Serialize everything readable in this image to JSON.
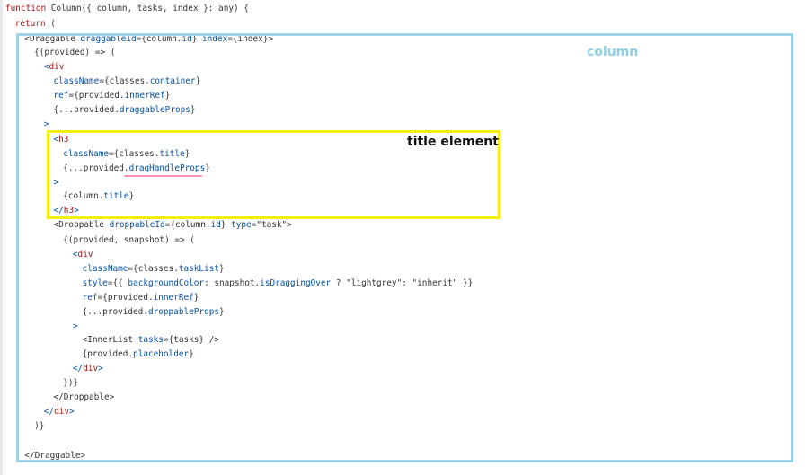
{
  "code_lines": [
    {
      "indent": "",
      "segments": [
        {
          "t": "kw",
          "v": "function"
        },
        {
          "t": "txt",
          "v": " Column({ column, tasks, index }: any) {"
        }
      ]
    },
    {
      "indent": "  ",
      "segments": [
        {
          "t": "kw",
          "v": "return"
        },
        {
          "t": "txt",
          "v": " ("
        }
      ]
    },
    {
      "indent": "    ",
      "segments": [
        {
          "t": "txt",
          "v": "<"
        },
        {
          "t": "txt",
          "v": "Draggable"
        },
        {
          "t": "txt",
          "v": " "
        },
        {
          "t": "attr",
          "v": "draggableId"
        },
        {
          "t": "txt",
          "v": "={column."
        },
        {
          "t": "prop",
          "v": "id"
        },
        {
          "t": "txt",
          "v": "} "
        },
        {
          "t": "attr",
          "v": "index"
        },
        {
          "t": "txt",
          "v": "={index}>"
        }
      ]
    },
    {
      "indent": "      ",
      "segments": [
        {
          "t": "txt",
          "v": "{(provided) => ("
        }
      ]
    },
    {
      "indent": "        ",
      "segments": [
        {
          "t": "punc",
          "v": "<"
        },
        {
          "t": "tag",
          "v": "div"
        }
      ]
    },
    {
      "indent": "          ",
      "segments": [
        {
          "t": "attr",
          "v": "className"
        },
        {
          "t": "txt",
          "v": "={classes."
        },
        {
          "t": "prop",
          "v": "container"
        },
        {
          "t": "txt",
          "v": "}"
        }
      ]
    },
    {
      "indent": "          ",
      "segments": [
        {
          "t": "attr",
          "v": "ref"
        },
        {
          "t": "txt",
          "v": "={provided."
        },
        {
          "t": "prop",
          "v": "innerRef"
        },
        {
          "t": "txt",
          "v": "}"
        }
      ]
    },
    {
      "indent": "          ",
      "segments": [
        {
          "t": "txt",
          "v": "{...provided."
        },
        {
          "t": "prop",
          "v": "draggableProps"
        },
        {
          "t": "txt",
          "v": "}"
        }
      ]
    },
    {
      "indent": "        ",
      "segments": [
        {
          "t": "punc",
          "v": ">"
        }
      ]
    },
    {
      "indent": "          ",
      "segments": [
        {
          "t": "punc",
          "v": "<"
        },
        {
          "t": "tag",
          "v": "h3"
        }
      ]
    },
    {
      "indent": "            ",
      "segments": [
        {
          "t": "attr",
          "v": "className"
        },
        {
          "t": "txt",
          "v": "={classes."
        },
        {
          "t": "prop",
          "v": "title"
        },
        {
          "t": "txt",
          "v": "}"
        }
      ]
    },
    {
      "indent": "            ",
      "segments": [
        {
          "t": "txt",
          "v": "{...provided."
        },
        {
          "t": "prop",
          "v": "dragHandleProps"
        },
        {
          "t": "txt",
          "v": "}"
        }
      ]
    },
    {
      "indent": "          ",
      "segments": [
        {
          "t": "punc",
          "v": ">"
        }
      ]
    },
    {
      "indent": "            ",
      "segments": [
        {
          "t": "txt",
          "v": "{column."
        },
        {
          "t": "prop",
          "v": "title"
        },
        {
          "t": "txt",
          "v": "}"
        }
      ]
    },
    {
      "indent": "          ",
      "segments": [
        {
          "t": "punc",
          "v": "</"
        },
        {
          "t": "tag",
          "v": "h3"
        },
        {
          "t": "punc",
          "v": ">"
        }
      ]
    },
    {
      "indent": "          ",
      "segments": [
        {
          "t": "txt",
          "v": "<Droppable "
        },
        {
          "t": "attr",
          "v": "droppableId"
        },
        {
          "t": "txt",
          "v": "={column."
        },
        {
          "t": "prop",
          "v": "id"
        },
        {
          "t": "txt",
          "v": "} "
        },
        {
          "t": "attr",
          "v": "type"
        },
        {
          "t": "txt",
          "v": "=\"task\">"
        }
      ]
    },
    {
      "indent": "            ",
      "segments": [
        {
          "t": "txt",
          "v": "{(provided, snapshot) => ("
        }
      ]
    },
    {
      "indent": "              ",
      "segments": [
        {
          "t": "punc",
          "v": "<"
        },
        {
          "t": "tag",
          "v": "div"
        }
      ]
    },
    {
      "indent": "                ",
      "segments": [
        {
          "t": "attr",
          "v": "className"
        },
        {
          "t": "txt",
          "v": "={classes."
        },
        {
          "t": "prop",
          "v": "taskList"
        },
        {
          "t": "txt",
          "v": "}"
        }
      ]
    },
    {
      "indent": "                ",
      "segments": [
        {
          "t": "attr",
          "v": "style"
        },
        {
          "t": "txt",
          "v": "={{ "
        },
        {
          "t": "prop",
          "v": "backgroundColor"
        },
        {
          "t": "txt",
          "v": ": snapshot."
        },
        {
          "t": "prop",
          "v": "isDraggingOver"
        },
        {
          "t": "txt",
          "v": " ? \"lightgrey\": \"inherit\" }}"
        }
      ]
    },
    {
      "indent": "                ",
      "segments": [
        {
          "t": "attr",
          "v": "ref"
        },
        {
          "t": "txt",
          "v": "={provided."
        },
        {
          "t": "prop",
          "v": "innerRef"
        },
        {
          "t": "txt",
          "v": "}"
        }
      ]
    },
    {
      "indent": "                ",
      "segments": [
        {
          "t": "txt",
          "v": "{...provided."
        },
        {
          "t": "prop",
          "v": "droppableProps"
        },
        {
          "t": "txt",
          "v": "}"
        }
      ]
    },
    {
      "indent": "              ",
      "segments": [
        {
          "t": "punc",
          "v": ">"
        }
      ]
    },
    {
      "indent": "                ",
      "segments": [
        {
          "t": "txt",
          "v": "<InnerList "
        },
        {
          "t": "attr",
          "v": "tasks"
        },
        {
          "t": "txt",
          "v": "={tasks} />"
        }
      ]
    },
    {
      "indent": "                ",
      "segments": [
        {
          "t": "txt",
          "v": "{provided."
        },
        {
          "t": "prop",
          "v": "placeholder"
        },
        {
          "t": "txt",
          "v": "}"
        }
      ]
    },
    {
      "indent": "              ",
      "segments": [
        {
          "t": "punc",
          "v": "</"
        },
        {
          "t": "tag",
          "v": "div"
        },
        {
          "t": "punc",
          "v": ">"
        }
      ]
    },
    {
      "indent": "            ",
      "segments": [
        {
          "t": "txt",
          "v": "})}"
        }
      ]
    },
    {
      "indent": "          ",
      "segments": [
        {
          "t": "txt",
          "v": "</Droppable>"
        }
      ]
    },
    {
      "indent": "        ",
      "segments": [
        {
          "t": "punc",
          "v": "</"
        },
        {
          "t": "tag",
          "v": "div"
        },
        {
          "t": "punc",
          "v": ">"
        }
      ]
    },
    {
      "indent": "      ",
      "segments": [
        {
          "t": "txt",
          "v": ")}"
        }
      ]
    },
    {
      "indent": "",
      "segments": []
    },
    {
      "indent": "    ",
      "segments": [
        {
          "t": "txt",
          "v": "</Draggable>"
        }
      ]
    }
  ],
  "annotations": {
    "column_label": "column",
    "title_label": "title element"
  },
  "colors": {
    "column_box": "#9ed4e4",
    "title_box": "#f5ec10",
    "underline": "#f28fb4",
    "keyword": "#a31515",
    "attribute": "#0451a5"
  }
}
